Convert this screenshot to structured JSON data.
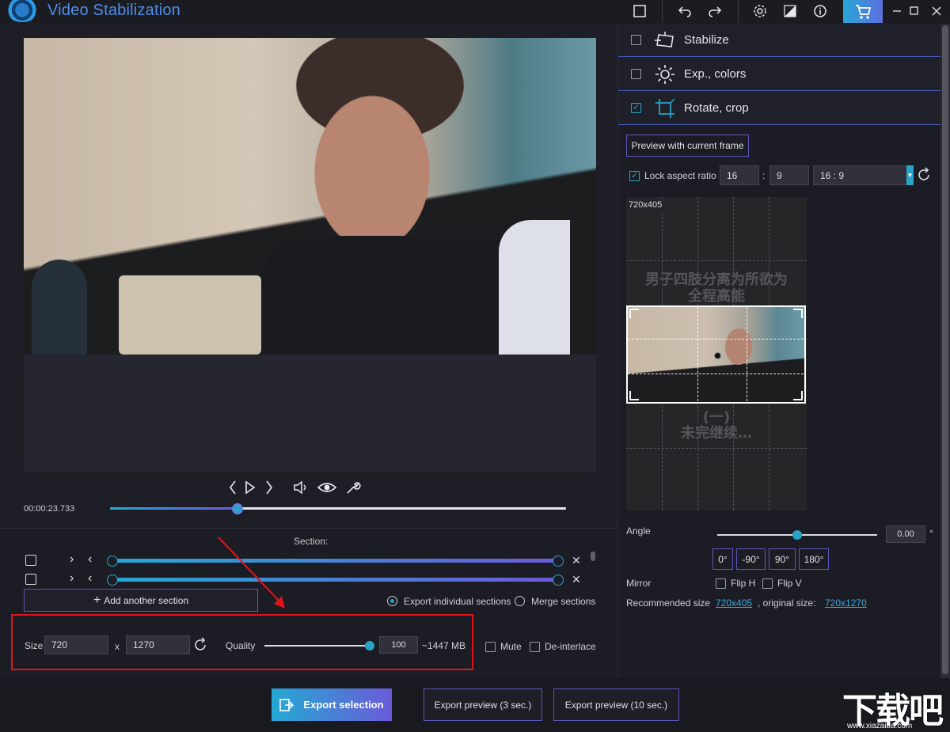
{
  "app": {
    "title": "Video Stabilization"
  },
  "playback": {
    "timecode": "00:00:23.733",
    "progress_fraction": 0.28
  },
  "section": {
    "label": "Section:",
    "add_button": "Add another section",
    "export_individual": "Export individual sections",
    "merge_sections": "Merge sections",
    "selected_mode": "export_individual"
  },
  "output": {
    "size_label": "Size",
    "width": "720",
    "x": "x",
    "height": "1270",
    "quality_label": "Quality",
    "quality_value": "100",
    "estimated_size": "~1447 MB",
    "mute_label": "Mute",
    "deinterlace_label": "De-interlace"
  },
  "export": {
    "selection": "Export selection",
    "preview3": "Export preview (3 sec.)",
    "preview10": "Export preview (10 sec.)"
  },
  "panels": [
    {
      "label": "Stabilize",
      "checked": false,
      "icon": "stabilize-icon"
    },
    {
      "label": "Exp., colors",
      "checked": false,
      "icon": "sun-icon"
    },
    {
      "label": "Rotate, crop",
      "checked": true,
      "icon": "crop-icon"
    }
  ],
  "crop": {
    "preview_button": "Preview with current frame",
    "lock_aspect_label": "Lock aspect ratio",
    "aspect_w": "16",
    "colon": ":",
    "aspect_h": "9",
    "aspect_preset": "16 : 9",
    "canvas_size_label": "720x405",
    "caption_line1": "男子四肢分离为所欲为",
    "caption_line2": "全程高能",
    "caption_line3": "(一)",
    "caption_line4": "未完继续…",
    "angle_label": "Angle",
    "angle_value": "0.00",
    "degree_symbol": "°",
    "angle_buttons": [
      "0°",
      "-90°",
      "90°",
      "180°"
    ],
    "mirror_label": "Mirror",
    "flip_h": "Flip H",
    "flip_v": "Flip V",
    "recommended_label": "Recommended size",
    "recommended_value": "720x405",
    "original_label": ", original size:",
    "original_value": "720x1270"
  },
  "watermark": {
    "text": "下载吧",
    "url": "www.xiazaiba.com"
  },
  "colors": {
    "accent": "#2aa3c8",
    "accent2": "#6b5bd8",
    "highlight": "#e0141a"
  }
}
